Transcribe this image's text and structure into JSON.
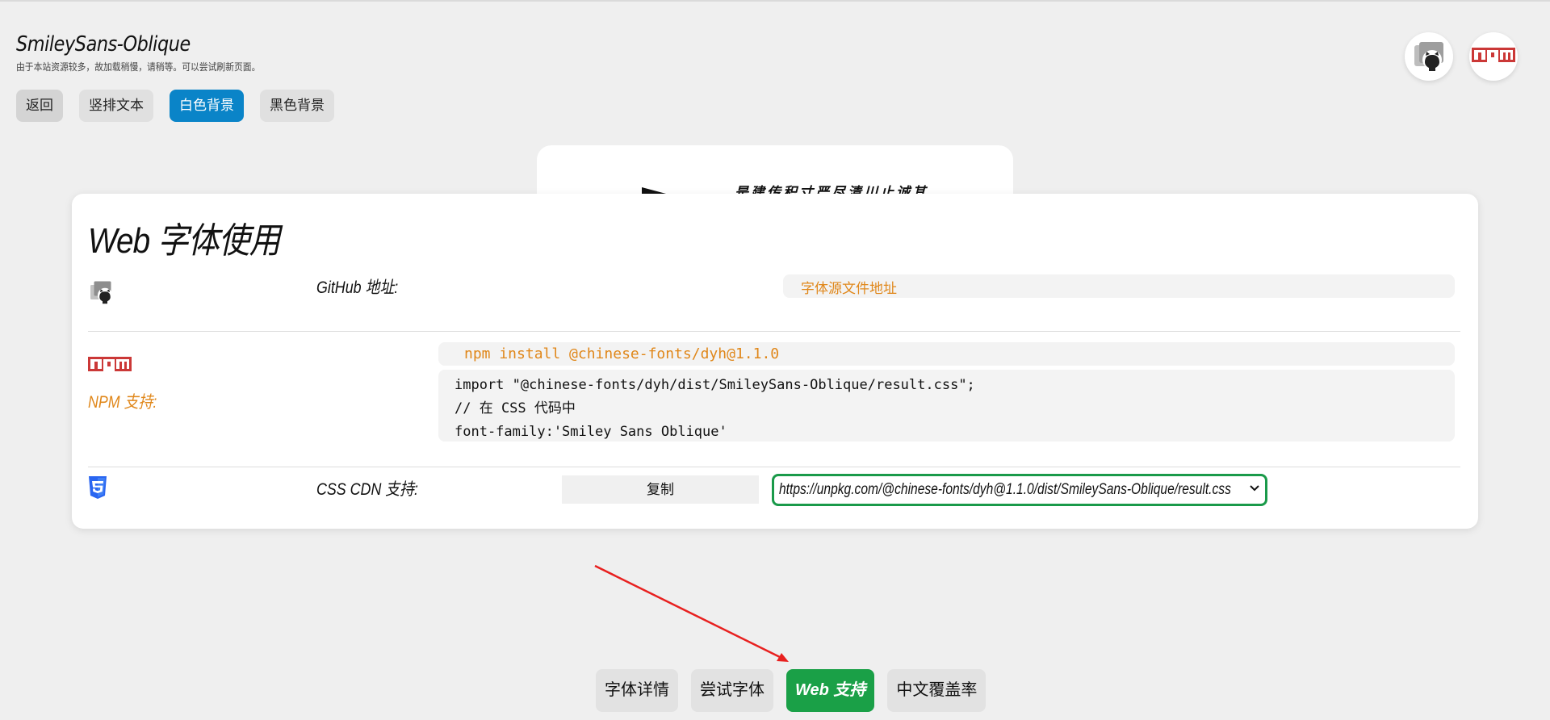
{
  "header": {
    "title": "SmileySans-Oblique",
    "subtitle": "由于本站资源较多，故加载稍慢，请稍等。可以尝试刷新页面。"
  },
  "top_buttons": [
    {
      "label": "返回"
    },
    {
      "label": "竖排文本"
    },
    {
      "label": "白色背景",
      "active": true
    },
    {
      "label": "黑色背景"
    }
  ],
  "peek_card": {
    "text": "是建传积寸严尽清川止诚其"
  },
  "card": {
    "title": "Web 字体使用",
    "github": {
      "label": "GitHub 地址:",
      "value": "字体源文件地址"
    },
    "npm": {
      "icon_text": "npm",
      "label": "NPM 支持:",
      "install_cmd": "npm install @chinese-fonts/dyh@1.1.0",
      "code_lines": [
        "import \"@chinese-fonts/dyh/dist/SmileySans-Oblique/result.css\";",
        "// 在 CSS 代码中",
        "font-family:'Smiley Sans Oblique'"
      ]
    },
    "cdn": {
      "label": "CSS CDN 支持:",
      "copy_label": "复制",
      "selected_url": "https://unpkg.com/@chinese-fonts/dyh@1.1.0/dist/SmileySans-Oblique/result.css"
    }
  },
  "bottom_tabs": [
    {
      "label": "字体详情"
    },
    {
      "label": "尝试字体"
    },
    {
      "label": "Web 支持",
      "active": true
    },
    {
      "label": "中文覆盖率"
    }
  ],
  "colors": {
    "accent_blue": "#0a84c8",
    "accent_green": "#1aa047",
    "orange_text": "#e0871a",
    "npm_red": "#cb3837",
    "css_blue": "#2965f1",
    "annotation_arrow": "#e8201f"
  },
  "icons": {
    "github": "github-octocat-icon",
    "npm": "npm-logo-icon",
    "css": "css3-icon",
    "select": "chevron-down-icon"
  }
}
